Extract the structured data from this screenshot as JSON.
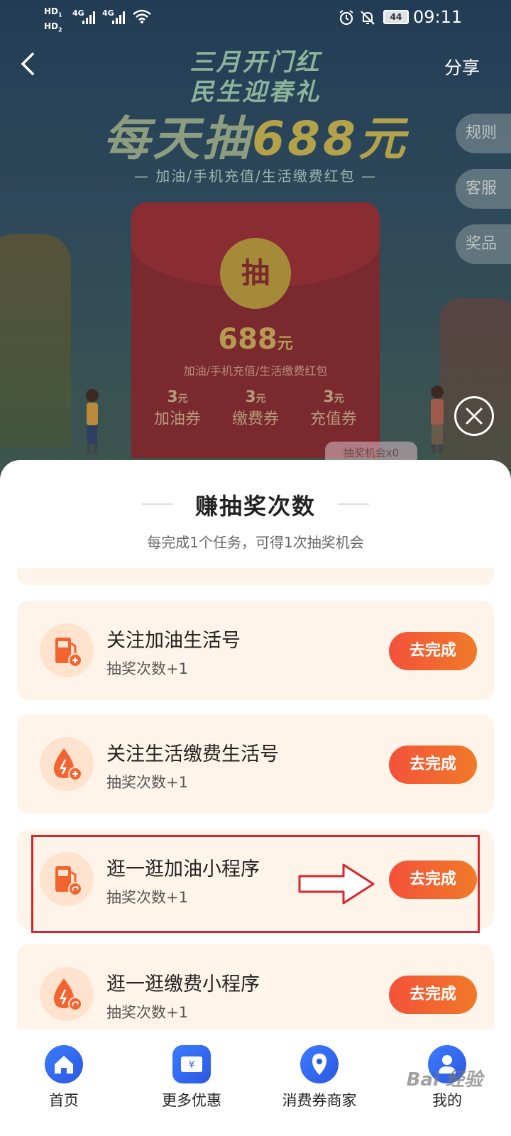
{
  "status": {
    "hd1": "HD",
    "hd1_n": "1",
    "hd2": "HD",
    "hd2_n": "2",
    "net1": "4G",
    "net2": "4G",
    "battery": "44",
    "time": "09:11"
  },
  "header": {
    "share": "分享"
  },
  "promo": {
    "line1": "三月开门红",
    "line2": "民生迎春礼",
    "main_prefix": "每天抽",
    "main_amount": "688元",
    "tagline": "— 加油/手机充值/生活缴费红包 —",
    "side_buttons": [
      "规则",
      "客服",
      "奖品"
    ],
    "coin": "抽",
    "amount": "688",
    "amount_unit": "元",
    "amount_desc": "加油/手机充值/生活缴费红包",
    "vouchers": [
      {
        "value": "3",
        "unit": "元",
        "name": "加油券"
      },
      {
        "value": "3",
        "unit": "元",
        "name": "缴费券"
      },
      {
        "value": "3",
        "unit": "元",
        "name": "充值券"
      }
    ],
    "chances": "抽奖机会x0"
  },
  "sheet": {
    "title": "赚抽奖次数",
    "subtitle": "每完成1个任务，可得1次抽奖机会",
    "tasks": [
      {
        "name": "关注加油生活号",
        "reward": "抽奖次数+1",
        "button": "去完成",
        "icon": "fuel-pump-plus-icon"
      },
      {
        "name": "关注生活缴费生活号",
        "reward": "抽奖次数+1",
        "button": "去完成",
        "icon": "water-drop-plus-icon"
      },
      {
        "name": "逛一逛加油小程序",
        "reward": "抽奖次数+1",
        "button": "去完成",
        "icon": "fuel-pump-link-icon"
      },
      {
        "name": "逛一逛缴费小程序",
        "reward": "抽奖次数+1",
        "button": "去完成",
        "icon": "water-drop-link-icon"
      }
    ]
  },
  "nav": {
    "items": [
      {
        "label": "首页",
        "icon": "home-icon"
      },
      {
        "label": "更多优惠",
        "icon": "coupon-icon"
      },
      {
        "label": "消费券商家",
        "icon": "location-pin-icon"
      },
      {
        "label": "我的",
        "icon": "user-icon"
      }
    ]
  },
  "watermark": "Bai 经验",
  "colors": {
    "accent": "#f3523a",
    "highlight": "#d9262c",
    "task_bg": "#fff4ea",
    "nav_blue": "#3b7cff"
  }
}
